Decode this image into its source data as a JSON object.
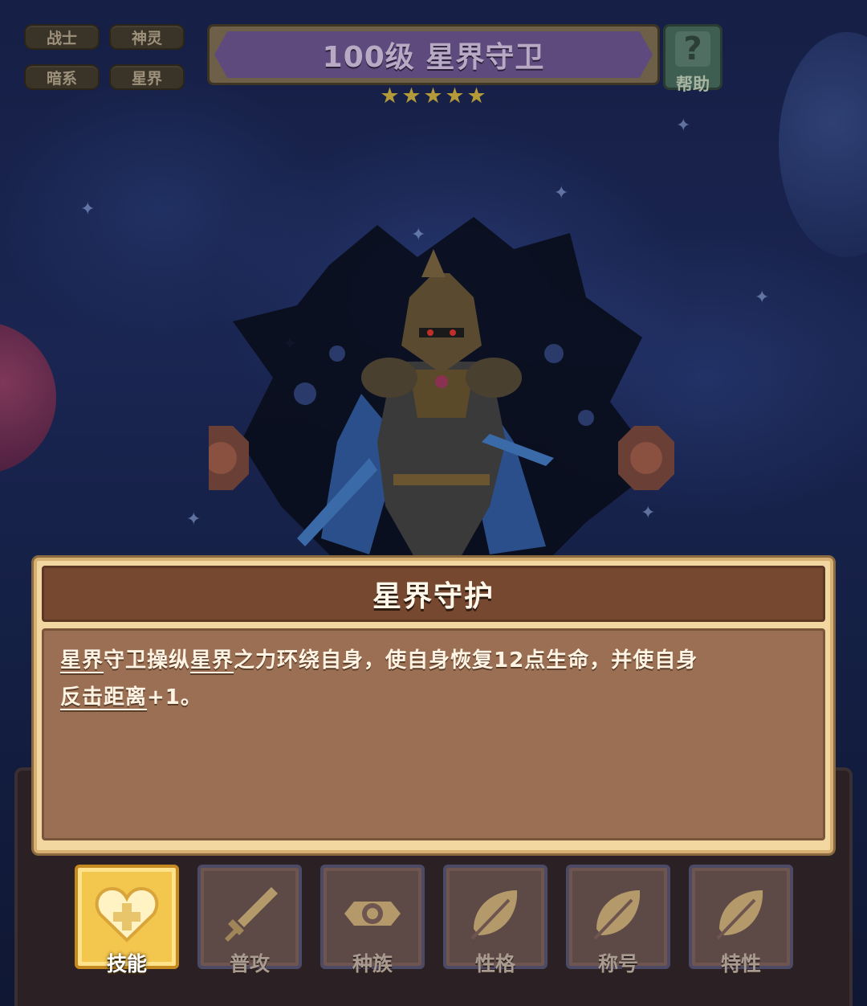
{
  "tags": [
    "战士",
    "神灵",
    "暗系",
    "星界"
  ],
  "title": "100级 星界守卫",
  "star_rating": 5,
  "help": {
    "label": "帮助",
    "icon": "question-mark-icon"
  },
  "skill": {
    "name": "星界守护",
    "description_parts": [
      "星界",
      "守卫操纵",
      "星界",
      "之力环绕自身，使自身恢复12点生命，并使自身",
      "反击距离",
      "+1。"
    ]
  },
  "tabs": [
    {
      "label": "技能",
      "icon": "heart-cross-icon",
      "active": true
    },
    {
      "label": "普攻",
      "icon": "sword-icon",
      "active": false
    },
    {
      "label": "种族",
      "icon": "race-emblem-icon",
      "active": false
    },
    {
      "label": "性格",
      "icon": "leaf-icon",
      "active": false
    },
    {
      "label": "称号",
      "icon": "leaf-icon",
      "active": false
    },
    {
      "label": "特性",
      "icon": "leaf-icon",
      "active": false
    }
  ],
  "colors": {
    "title_banner": "#5f4a7e",
    "dialog_header": "#75482f",
    "dialog_body": "#9a6f53",
    "active_tab": "#f3c64e",
    "inactive_tab": "#5d4a47"
  }
}
